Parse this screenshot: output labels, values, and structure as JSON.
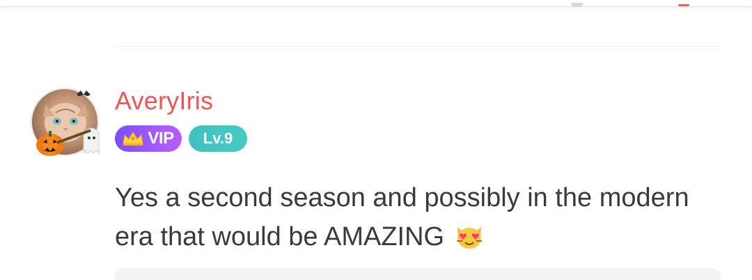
{
  "comment": {
    "author": {
      "username": "AveryIris",
      "vip_label": "VIP",
      "level_label": "Lv.9"
    },
    "lines": [
      "Yes a second season and possibly in the modern",
      "era that would be AMAZING"
    ],
    "emoji": "heart-eyes-cat"
  },
  "colors": {
    "username": "#f05454",
    "vip_badge": "#8a52ff",
    "level_badge": "#44c6c2",
    "text": "#3a3a3a"
  },
  "icons": {
    "avatar_decoration": "halloween-frame",
    "vip_icon": "crown-icon"
  }
}
